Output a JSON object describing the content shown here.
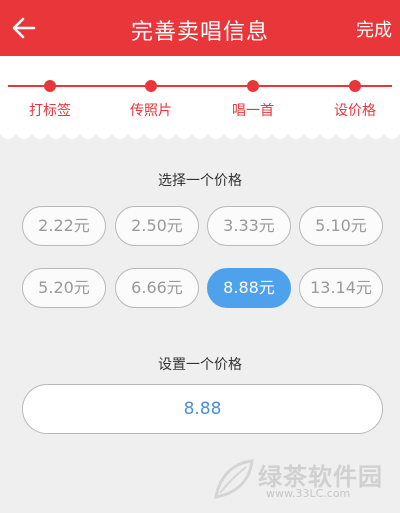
{
  "header": {
    "title": "完善卖唱信息",
    "done_label": "完成",
    "background": "#e8363b"
  },
  "steps": [
    {
      "label": "打标签"
    },
    {
      "label": "传照片"
    },
    {
      "label": "唱一首"
    },
    {
      "label": "设价格"
    }
  ],
  "price_section": {
    "title": "选择一个价格",
    "options": [
      {
        "label": "2.22元",
        "selected": false
      },
      {
        "label": "2.50元",
        "selected": false
      },
      {
        "label": "3.33元",
        "selected": false
      },
      {
        "label": "5.10元",
        "selected": false
      },
      {
        "label": "5.20元",
        "selected": false
      },
      {
        "label": "6.66元",
        "selected": false
      },
      {
        "label": "8.88元",
        "selected": true
      },
      {
        "label": "13.14元",
        "selected": false
      }
    ],
    "selected_color": "#4ea2ec"
  },
  "custom_section": {
    "title": "设置一个价格",
    "value": "8.88"
  },
  "watermark": {
    "name": "绿茶软件园",
    "url": "www.33LC.com"
  }
}
